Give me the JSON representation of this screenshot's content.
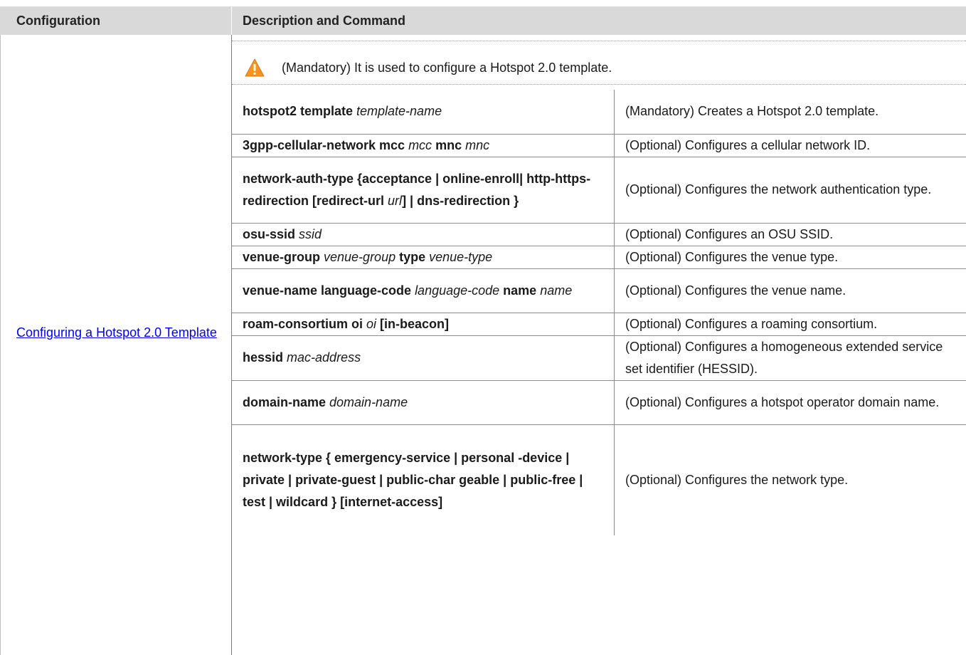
{
  "header": {
    "col1": "Configuration",
    "col2": "Description and Command"
  },
  "config_link": "Configuring a Hotspot 2.0 Template",
  "warning_text": "(Mandatory) It is used to configure a Hotspot 2.0 template.",
  "rows": [
    {
      "cmd": [
        [
          "b",
          "hotspot2 template "
        ],
        [
          "i",
          "template-name"
        ]
      ],
      "desc": "(Mandatory) Creates a Hotspot 2.0 template."
    },
    {
      "cmd": [
        [
          "b",
          "3gpp-cellular-network mcc "
        ],
        [
          "i",
          "mcc"
        ],
        [
          "b",
          " mnc "
        ],
        [
          "i",
          "mnc"
        ]
      ],
      "desc": "(Optional) Configures a cellular network ID."
    },
    {
      "cmd": [
        [
          "b",
          "network-auth-type {acceptance | online-enroll| http-https-redirection [redirect-url "
        ],
        [
          "i",
          "url"
        ],
        [
          "b",
          "] | dns-redirection }"
        ]
      ],
      "desc": "(Optional) Configures the network authentication type."
    },
    {
      "cmd": [
        [
          "b",
          "osu-ssid "
        ],
        [
          "i",
          "ssid"
        ]
      ],
      "desc": "(Optional) Configures an OSU SSID."
    },
    {
      "cmd": [
        [
          "b",
          "venue-group "
        ],
        [
          "i",
          "venue-group"
        ],
        [
          "b",
          " type "
        ],
        [
          "i",
          "venue-type"
        ]
      ],
      "desc": "(Optional) Configures the venue type."
    },
    {
      "cmd": [
        [
          "b",
          "venue-name language-code "
        ],
        [
          "i",
          "language-code"
        ],
        [
          "b",
          " name "
        ],
        [
          "i",
          "name"
        ]
      ],
      "desc": "(Optional) Configures the venue name."
    },
    {
      "cmd": [
        [
          "b",
          "roam-consortium oi "
        ],
        [
          "i",
          "oi"
        ],
        [
          "b",
          " [in-beacon]"
        ]
      ],
      "desc": "(Optional) Configures a roaming consortium."
    },
    {
      "cmd": [
        [
          "b",
          "hessid "
        ],
        [
          "i",
          "mac-address"
        ]
      ],
      "desc": "(Optional) Configures a homogeneous extended service set identifier (HESSID)."
    },
    {
      "cmd": [
        [
          "b",
          "domain-name "
        ],
        [
          "i",
          "domain-name"
        ]
      ],
      "desc": "(Optional) Configures a hotspot operator domain name."
    },
    {
      "cmd": [
        [
          "b",
          "network-type { emergency-service | personal -device | private | private-guest | public-char geable | public-free | test | wildcard } [internet-access]"
        ]
      ],
      "desc": "(Optional) Configures the network type."
    }
  ],
  "icons": {
    "warning": "warning-triangle-icon",
    "warning_fill": "#f7941d",
    "link_color": "#0000ff",
    "header_bg": "#d9d9d9"
  }
}
